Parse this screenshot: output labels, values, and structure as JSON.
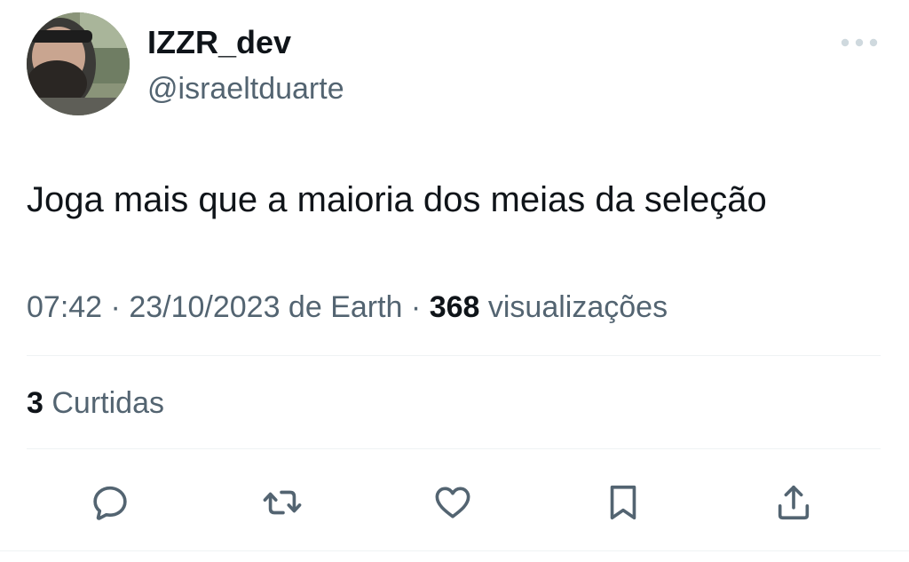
{
  "author": {
    "display_name": "IZZR_dev",
    "handle": "@israeltduarte",
    "avatar_icon": "user-photo-avatar"
  },
  "menu": {
    "icon": "more-horizontal-icon"
  },
  "tweet": {
    "text": "Joga mais que a maioria dos meias da seleção",
    "time": "07:42",
    "separator": " · ",
    "date": "23/10/2023",
    "source_prefix": " de ",
    "source": "Earth",
    "views_count": "368",
    "views_label": " visualizações"
  },
  "stats": {
    "likes_count": "3",
    "likes_label": " Curtidas"
  },
  "actions": [
    {
      "name": "reply",
      "icon": "reply-bubble-icon"
    },
    {
      "name": "retweet",
      "icon": "retweet-icon"
    },
    {
      "name": "like",
      "icon": "heart-icon"
    },
    {
      "name": "bookmark",
      "icon": "bookmark-icon"
    },
    {
      "name": "share",
      "icon": "share-icon"
    }
  ],
  "colors": {
    "text_primary": "#0f1419",
    "text_secondary": "#536471",
    "divider": "#eff3f4",
    "icon": "#536471"
  }
}
